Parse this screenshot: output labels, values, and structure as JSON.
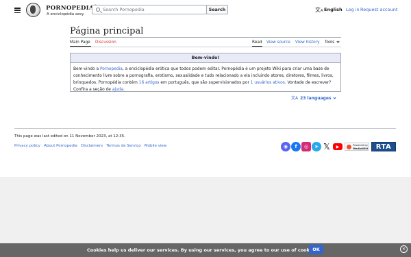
{
  "header": {
    "logo_title": "Pornopedia",
    "logo_reg": "®",
    "logo_tagline": "A enciclopédia sexy",
    "search_placeholder": "Search Pornopedia",
    "search_button": "Search",
    "language": "English",
    "login": "Log in",
    "request_account": "Request account"
  },
  "page": {
    "title": "Página principal",
    "tabs": {
      "main_page": "Main Page",
      "discussion": "Discussion",
      "read": "Read",
      "view_source": "View source",
      "view_history": "View history",
      "tools": "Tools"
    }
  },
  "welcome": {
    "heading": "Bem-vindo!",
    "t1": "Bem-vindo a ",
    "link_site": "Pornopedia",
    "t2": ", a enciclopédia erótica que todos podem editar. Pornopédia é um projeto Wiki para criar uma base de conhecimento livre sobre a pornografia, erotismo, sexualidade e tudo relacionado a ela incluindo atores, diretores, filmes, livros, brinquedos. Pornopédia contém ",
    "link_articles": "16 artigos",
    "t3": " em português, que são supervisionados por ",
    "link_users": "1 usuários ativos",
    "t4": ". Vontade de escrever? Confira a seção de ",
    "link_help": "ajuda",
    "t5": "."
  },
  "languages": "23 languages",
  "footer": {
    "last_edited": "This page was last edited on 11 November 2023, at 12:35.",
    "links": [
      "Privacy policy",
      "About Pornopedia",
      "Disclaimers",
      "Termos de Serviço",
      "Mobile view"
    ],
    "powered_by_l1": "Powered by",
    "powered_by_l2": "MediaWiki",
    "rta": "RTA"
  },
  "cookie": {
    "message": "Cookies help us deliver our services. By using our services, you agree to our use of cookies.",
    "ok": "OK"
  }
}
